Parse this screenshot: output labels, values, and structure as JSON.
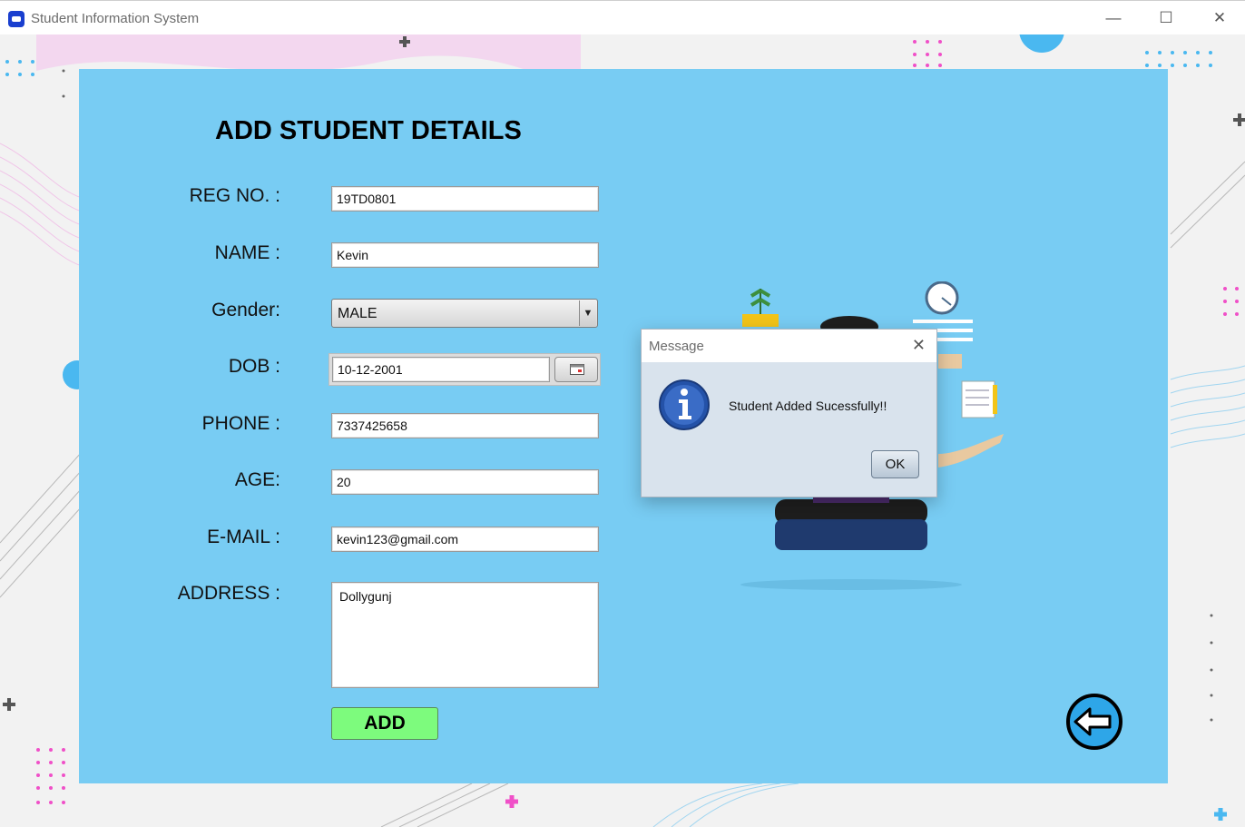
{
  "window": {
    "title": "Student Information System",
    "minimize": "—",
    "maximize": "☐",
    "close": "✕"
  },
  "form": {
    "heading": "ADD STUDENT DETAILS",
    "reg_label": "REG NO. :",
    "reg_value": "19TD0801",
    "name_label": "NAME :",
    "name_value": "Kevin",
    "gender_label": "Gender:",
    "gender_value": "MALE",
    "dob_label": "DOB :",
    "dob_value": "10-12-2001",
    "phone_label": "PHONE :",
    "phone_value": "7337425658",
    "age_label": "AGE:",
    "age_value": "20",
    "email_label": "E-MAIL :",
    "email_value": "kevin123@gmail.com",
    "address_label": "ADDRESS :",
    "address_value": "Dollygunj",
    "add_button": "ADD"
  },
  "dialog": {
    "title": "Message",
    "message": "Student Added Sucessfully!!",
    "ok": "OK",
    "close": "✕"
  },
  "icons": [
    "app-icon",
    "calendar-icon",
    "info-icon",
    "back-arrow-icon",
    "dropdown-arrow-icon"
  ]
}
